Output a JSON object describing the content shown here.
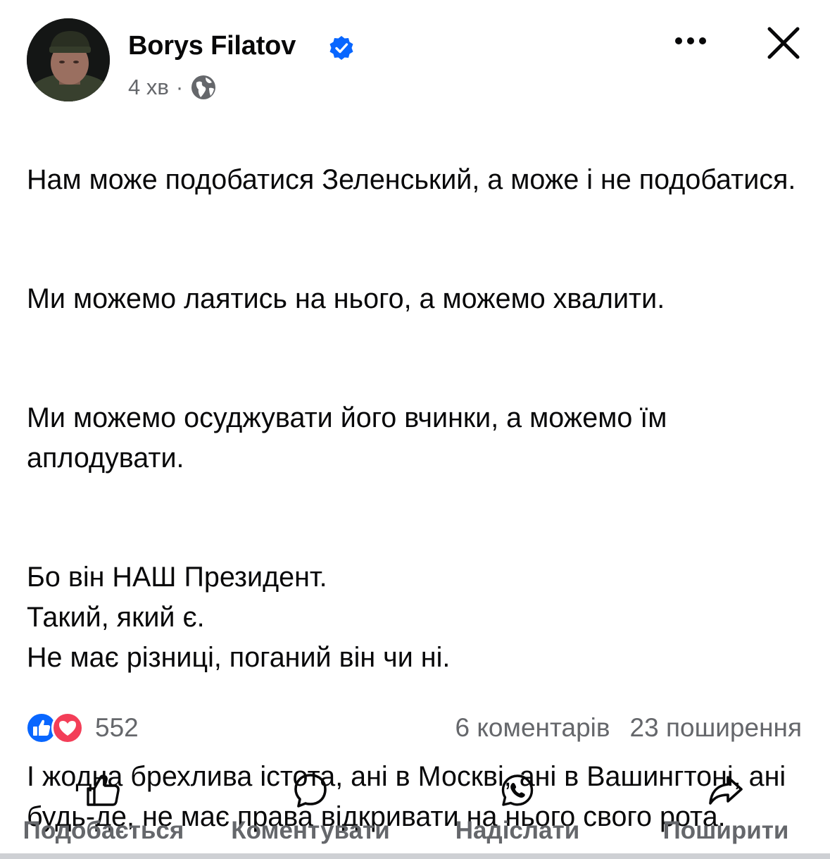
{
  "header": {
    "author_name": "Borys Filatov",
    "timestamp": "4 хв",
    "separator": "·",
    "avatar_icon": "profile-photo",
    "verified_icon": "verified-badge-icon",
    "privacy_icon": "globe-icon",
    "more_icon": "more-horizontal-icon",
    "close_icon": "close-icon"
  },
  "post": {
    "paragraphs": [
      "Нам може подобатися Зеленський, а може і не подобатися.",
      "Ми можемо лаятись на нього, а можемо хвалити.",
      "Ми можемо осуджувати його вчинки, а можемо їм аплодувати.",
      "Бо він НАШ Президент.\nТакий, який є.\nНе має різниці, поганий він чи ні.",
      "І жодна брехлива істота, ані в Москві, ані в Вашингтоні, ані будь-де, не має права відкривати на нього свого рота."
    ]
  },
  "engagement": {
    "reactions_count": "552",
    "comments": "6 коментарів",
    "shares": "23 поширення",
    "reaction_icons": [
      "like-reaction-icon",
      "love-reaction-icon"
    ]
  },
  "actions": {
    "like": "Подобається",
    "comment": "Коментувати",
    "send": "Надіслати",
    "share": "Поширити"
  },
  "colors": {
    "text": "#080809",
    "secondary_text": "#65676b",
    "verified_blue": "#0866ff",
    "like_blue": "#0866ff",
    "love_red": "#f33e58"
  }
}
